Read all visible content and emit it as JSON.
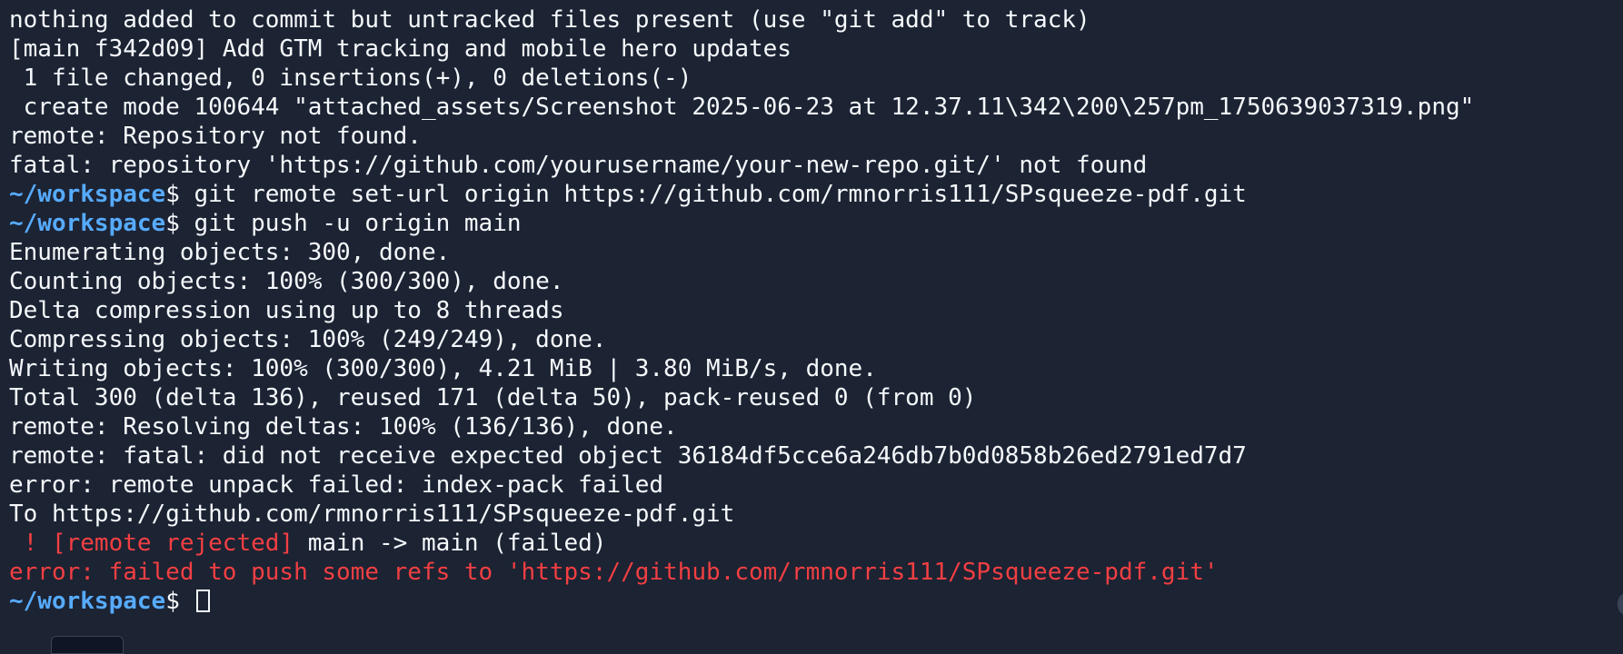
{
  "terminal": {
    "lines": {
      "l1": "nothing added to commit but untracked files present (use \"git add\" to track)",
      "l2": "[main f342d09] Add GTM tracking and mobile hero updates",
      "l3": " 1 file changed, 0 insertions(+), 0 deletions(-)",
      "l4": " create mode 100644 \"attached_assets/Screenshot 2025-06-23 at 12.37.11\\342\\200\\257pm_1750639037319.png\"",
      "l5": "remote: Repository not found.",
      "l6": "fatal: repository 'https://github.com/yourusername/your-new-repo.git/' not found",
      "l7_path": "~/workspace",
      "l7_cmd": "$ git remote set-url origin https://github.com/rmnorris111/SPsqueeze-pdf.git",
      "l8_path": "~/workspace",
      "l8_cmd": "$ git push -u origin main",
      "l9": "Enumerating objects: 300, done.",
      "l10": "Counting objects: 100% (300/300), done.",
      "l11": "Delta compression using up to 8 threads",
      "l12": "Compressing objects: 100% (249/249), done.",
      "l13": "Writing objects: 100% (300/300), 4.21 MiB | 3.80 MiB/s, done.",
      "l14": "Total 300 (delta 136), reused 171 (delta 50), pack-reused 0 (from 0)",
      "l15": "remote: Resolving deltas: 100% (136/136), done.",
      "l16": "remote: fatal: did not receive expected object 36184df5cce6a246db7b0d0858b26ed2791ed7d7",
      "l17": "error: remote unpack failed: index-pack failed",
      "l18": "To https://github.com/rmnorris111/SPsqueeze-pdf.git",
      "l19_err": " ! [remote rejected]",
      "l19_rest": " main -> main (failed)",
      "l20": "error: failed to push some refs to 'https://github.com/rmnorris111/SPsqueeze-pdf.git'",
      "l21_path": "~/workspace",
      "l21_prompt": "$ "
    }
  },
  "colors": {
    "background": "#1c2333",
    "foreground": "#f5f9fc",
    "prompt_path": "#57abff",
    "error": "#f23f42"
  }
}
